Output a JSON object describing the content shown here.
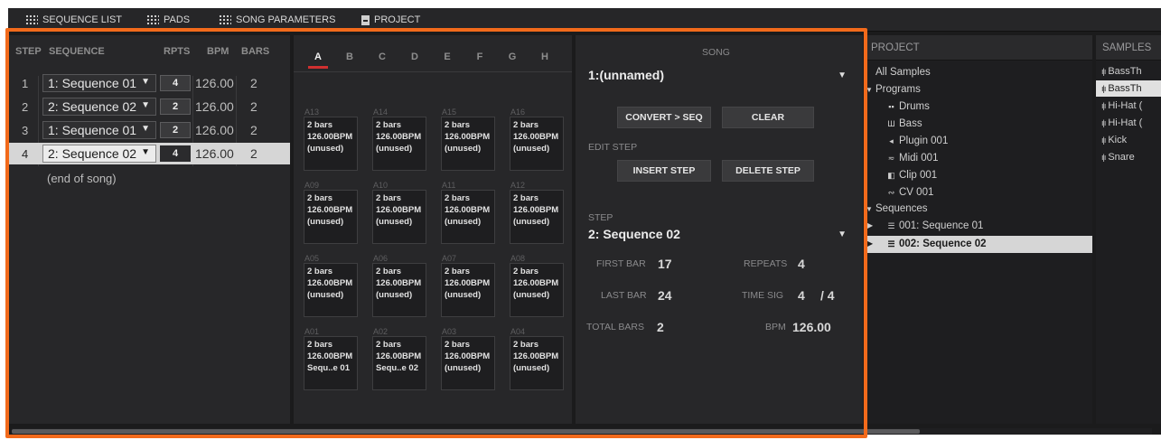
{
  "colors": {
    "highlight": "#f26a1b",
    "accent_tab": "#d03030",
    "selection": "#d6d6d6"
  },
  "topbar": {
    "tabs": [
      {
        "icon": "grid-icon",
        "label": "SEQUENCE LIST"
      },
      {
        "icon": "grid-icon",
        "label": "PADS"
      },
      {
        "icon": "grid-icon",
        "label": "SONG PARAMETERS"
      },
      {
        "icon": "document-icon",
        "label": "PROJECT"
      }
    ]
  },
  "sequence_list": {
    "headers": {
      "step": "STEP",
      "sequence": "SEQUENCE",
      "rpts": "RPTS",
      "bpm": "BPM",
      "bars": "BARS"
    },
    "rows": [
      {
        "step": "1",
        "sequence": "1: Sequence 01",
        "rpts": "4",
        "bpm": "126.00",
        "bars": "2"
      },
      {
        "step": "2",
        "sequence": "2: Sequence 02",
        "rpts": "2",
        "bpm": "126.00",
        "bars": "2"
      },
      {
        "step": "3",
        "sequence": "1: Sequence 01",
        "rpts": "2",
        "bpm": "126.00",
        "bars": "2"
      },
      {
        "step": "4",
        "sequence": "2: Sequence 02",
        "rpts": "4",
        "bpm": "126.00",
        "bars": "2"
      }
    ],
    "selected_row": 4,
    "end_label": "(end of song)"
  },
  "pads": {
    "tabs": [
      "A",
      "B",
      "C",
      "D",
      "E",
      "F",
      "G",
      "H"
    ],
    "active_tab": "A",
    "grid": [
      [
        {
          "id": "A13",
          "line1": "2 bars",
          "line2": "126.00BPM",
          "line3": "(unused)"
        },
        {
          "id": "A14",
          "line1": "2 bars",
          "line2": "126.00BPM",
          "line3": "(unused)"
        },
        {
          "id": "A15",
          "line1": "2 bars",
          "line2": "126.00BPM",
          "line3": "(unused)"
        },
        {
          "id": "A16",
          "line1": "2 bars",
          "line2": "126.00BPM",
          "line3": "(unused)"
        }
      ],
      [
        {
          "id": "A09",
          "line1": "2 bars",
          "line2": "126.00BPM",
          "line3": "(unused)"
        },
        {
          "id": "A10",
          "line1": "2 bars",
          "line2": "126.00BPM",
          "line3": "(unused)"
        },
        {
          "id": "A11",
          "line1": "2 bars",
          "line2": "126.00BPM",
          "line3": "(unused)"
        },
        {
          "id": "A12",
          "line1": "2 bars",
          "line2": "126.00BPM",
          "line3": "(unused)"
        }
      ],
      [
        {
          "id": "A05",
          "line1": "2 bars",
          "line2": "126.00BPM",
          "line3": "(unused)"
        },
        {
          "id": "A06",
          "line1": "2 bars",
          "line2": "126.00BPM",
          "line3": "(unused)"
        },
        {
          "id": "A07",
          "line1": "2 bars",
          "line2": "126.00BPM",
          "line3": "(unused)"
        },
        {
          "id": "A08",
          "line1": "2 bars",
          "line2": "126.00BPM",
          "line3": "(unused)"
        }
      ],
      [
        {
          "id": "A01",
          "line1": "2 bars",
          "line2": "126.00BPM",
          "line3": "Sequ..e 01"
        },
        {
          "id": "A02",
          "line1": "2 bars",
          "line2": "126.00BPM",
          "line3": "Sequ..e 02"
        },
        {
          "id": "A03",
          "line1": "2 bars",
          "line2": "126.00BPM",
          "line3": "(unused)"
        },
        {
          "id": "A04",
          "line1": "2 bars",
          "line2": "126.00BPM",
          "line3": "(unused)"
        }
      ]
    ]
  },
  "song": {
    "header": "SONG",
    "song_select": "1:(unnamed)",
    "convert_button": "CONVERT > SEQ",
    "clear_button": "CLEAR",
    "edit_step_label": "EDIT STEP",
    "insert_step_button": "INSERT STEP",
    "delete_step_button": "DELETE STEP",
    "step_label": "STEP",
    "step_select": "2: Sequence 02",
    "first_bar_label": "FIRST BAR",
    "first_bar": "17",
    "repeats_label": "REPEATS",
    "repeats": "4",
    "last_bar_label": "LAST BAR",
    "last_bar": "24",
    "time_sig_label": "TIME SIG",
    "time_sig_num": "4",
    "time_sig_den": "/ 4",
    "total_bars_label": "TOTAL BARS",
    "total_bars": "2",
    "bpm_label": "BPM",
    "bpm": "126.00"
  },
  "project": {
    "header": "PROJECT",
    "items": {
      "all_samples": "All Samples",
      "programs": "Programs",
      "drums": "Drums",
      "bass": "Bass",
      "plugin": "Plugin 001",
      "midi": "Midi 001",
      "clip": "Clip 001",
      "cv": "CV 001",
      "sequences": "Sequences",
      "seq1": "001: Sequence 01",
      "seq2": "002: Sequence 02"
    }
  },
  "samples": {
    "header": "SAMPLES",
    "items": [
      "BassTh",
      "BassTh",
      "Hi-Hat (",
      "Hi-Hat (",
      "Kick",
      "Snare"
    ],
    "selected_index": 1
  }
}
